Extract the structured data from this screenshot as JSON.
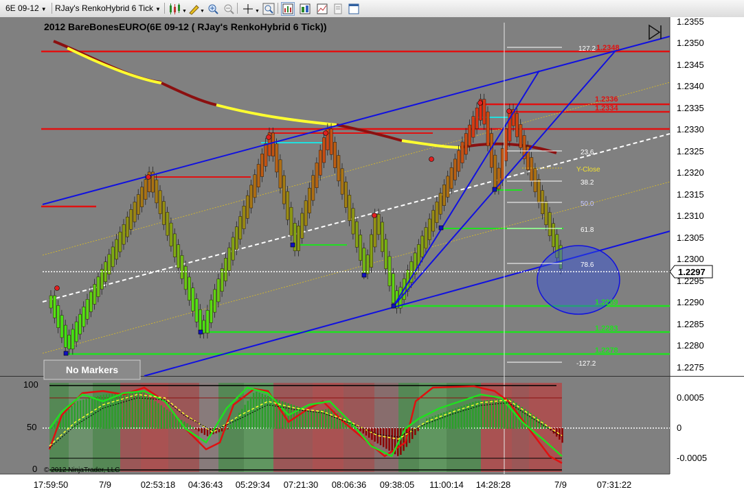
{
  "toolbar": {
    "instrument": "6E 09-12",
    "bar_type": "RJay's RenkoHybrid 6 Tick"
  },
  "chart": {
    "title": "2012 BareBonesEURO(6E 09-12 ( RJay's RenkoHybrid  6 Tick))",
    "price_axis": [
      "1.2355",
      "1.2350",
      "1.2345",
      "1.2340",
      "1.2335",
      "1.2330",
      "1.2325",
      "1.2320",
      "1.2315",
      "1.2310",
      "1.2305",
      "1.2300",
      "1.2295",
      "1.2290",
      "1.2285",
      "1.2280",
      "1.2275"
    ],
    "last_price": "1.2297",
    "no_markers_label": "No Markers",
    "fib_labels": [
      "127.2",
      "23.6",
      "38.2",
      "50.0",
      "61.8",
      "78.6",
      "-127.2"
    ],
    "level_labels_red": [
      "1.2348",
      "1.2336",
      "1.2334"
    ],
    "level_labels_green": [
      "1.2289",
      "1.2283",
      "1.2278"
    ],
    "y_close_label": "Y-Close",
    "osc_axis_left": [
      "100",
      "50",
      "0"
    ],
    "osc_axis_right": [
      "0.0005",
      "0",
      "-0.0005"
    ],
    "copyright": "© 2012 NinjaTrader, LLC",
    "time_axis": [
      "17:59:50",
      "7/9",
      "02:53:18",
      "04:36:43",
      "05:29:34",
      "07:21:30",
      "08:06:36",
      "09:38:05",
      "11:00:14",
      "14:28:28",
      "7/9",
      "07:31:22"
    ]
  }
}
